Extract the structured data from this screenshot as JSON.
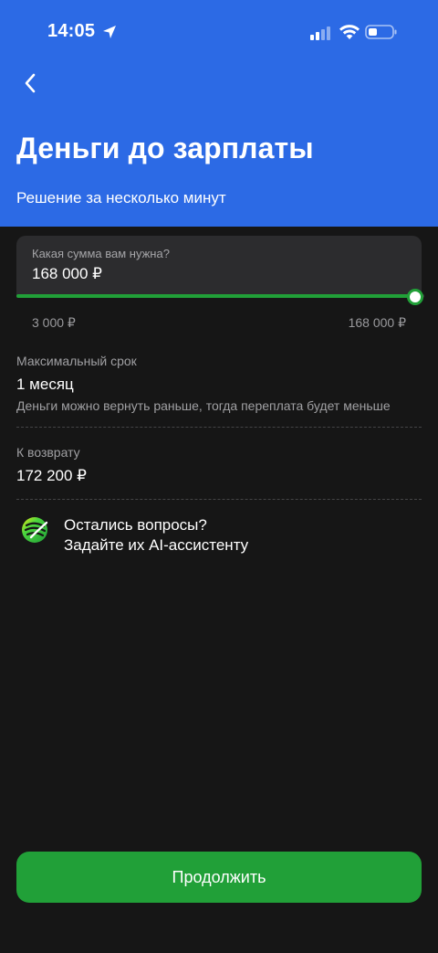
{
  "status_bar": {
    "time": "14:05"
  },
  "header": {
    "title": "Деньги до зарплаты",
    "subtitle": "Решение за несколько минут",
    "background_color": "#2c6ae5"
  },
  "amount": {
    "label": "Какая сумма вам нужна?",
    "value": "168 000 ₽",
    "slider_min_label": "3 000 ₽",
    "slider_max_label": "168 000 ₽",
    "slider_min": 3000,
    "slider_max": 168000,
    "slider_value": 168000
  },
  "term": {
    "label": "Максимальный срок",
    "value": "1 месяц",
    "hint": "Деньги можно вернуть раньше, тогда переплата будет меньше"
  },
  "repayment": {
    "label": "К возврату",
    "value": "172 200 ₽"
  },
  "assistant": {
    "line1": "Остались вопросы?",
    "line2": "Задайте их AI-ассистенту",
    "icon": "sber-logo-icon"
  },
  "continue_button": {
    "label": "Продолжить"
  },
  "colors": {
    "accent_green": "#21a038",
    "background": "#161616",
    "card": "#2c2c2e"
  }
}
